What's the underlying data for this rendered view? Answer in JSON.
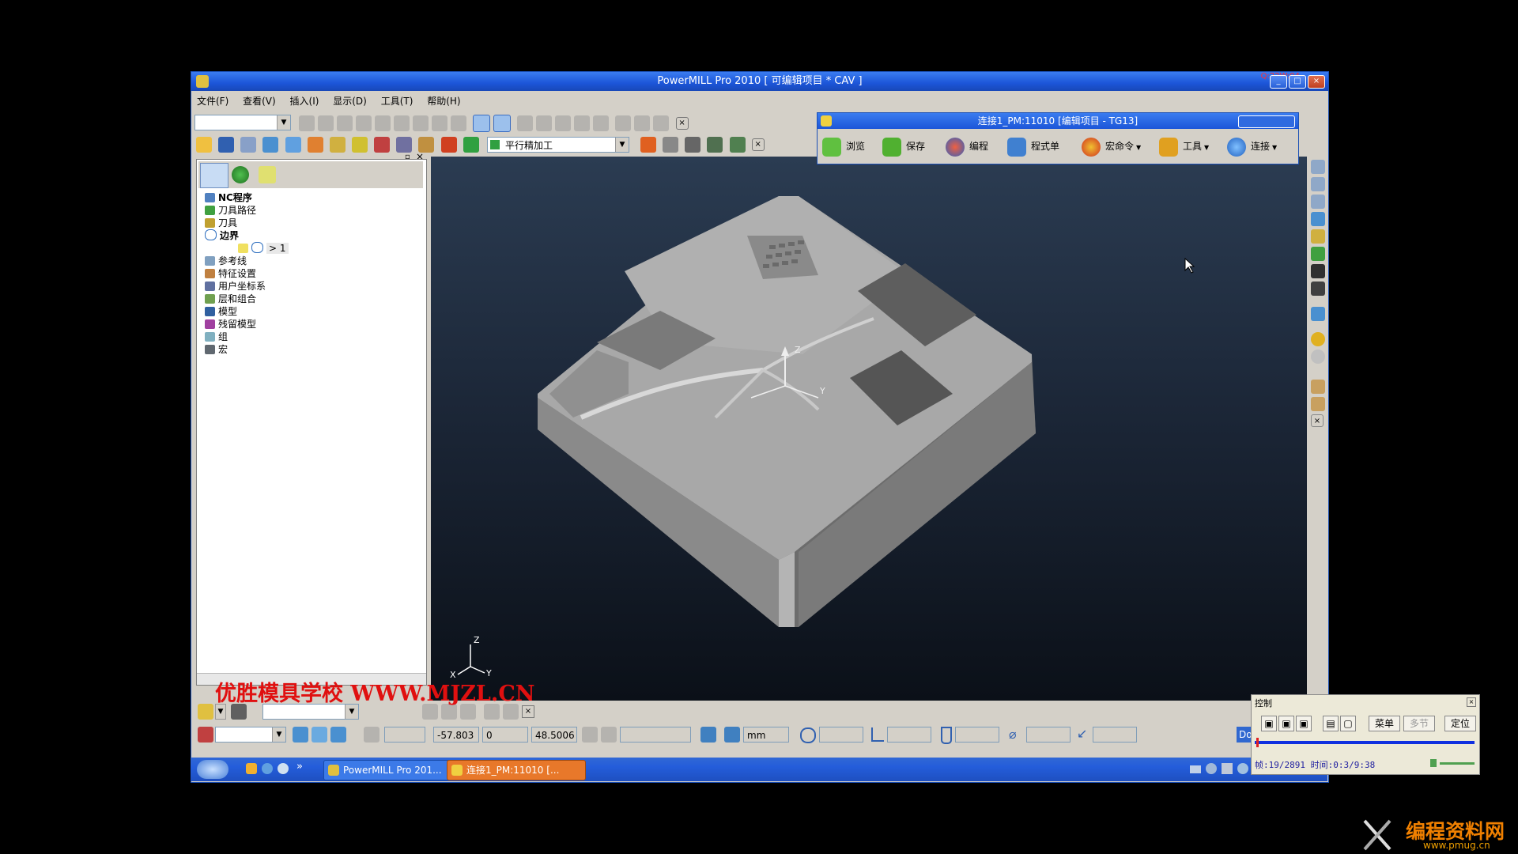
{
  "main_window": {
    "title": "PowerMILL Pro 2010    [ 可编辑项目 * CAV ]",
    "corner_label": "Q:22W:04"
  },
  "menu": [
    "文件(F)",
    "查看(V)",
    "插入(I)",
    "显示(D)",
    "工具(T)",
    "帮助(H)"
  ],
  "toolbar": {
    "strategy_combo": "平行精加工"
  },
  "explorer": {
    "items": [
      "NC程序",
      "刀具路径",
      "刀具",
      "边界",
      "参考线",
      "特征设置",
      "用户坐标系",
      "层和组合",
      "模型",
      "残留模型",
      "组",
      "宏"
    ],
    "boundary_child": "> 1"
  },
  "connection_window": {
    "title": "连接1_PM:11010  [编辑项目 - TG13]",
    "buttons": [
      "浏览",
      "保存",
      "编程",
      "程式单",
      "宏命令",
      "工具",
      "连接"
    ]
  },
  "viewport": {
    "axis_z": "Z",
    "axis_y": "Y",
    "triad_z": "Z",
    "triad_x": "X",
    "triad_y": "Y"
  },
  "status_bar": {
    "x": "-57.803",
    "y": "0",
    "z": "48.5006",
    "units": "mm",
    "do_label": "Do"
  },
  "watermark": "优胜模具学校 WWW.MJZL.CN",
  "taskbar": {
    "tasks": [
      "PowerMILL Pro 201...",
      "连接1_PM:11010  [..."
    ],
    "arrows": "»"
  },
  "control_panel": {
    "title": "控制",
    "menu_button": "菜单",
    "step_button": "多节",
    "locate_button": "定位",
    "frame_info": "帧:19/2891 时间:0:3/9:38",
    "progress": 0.007
  },
  "site_logo": {
    "text": "编程资料网",
    "url": "www.pmug.cn"
  },
  "colors": {
    "title_blue": "#1c55d8",
    "watermark_red": "#e01010",
    "logo_orange": "#f08000"
  }
}
